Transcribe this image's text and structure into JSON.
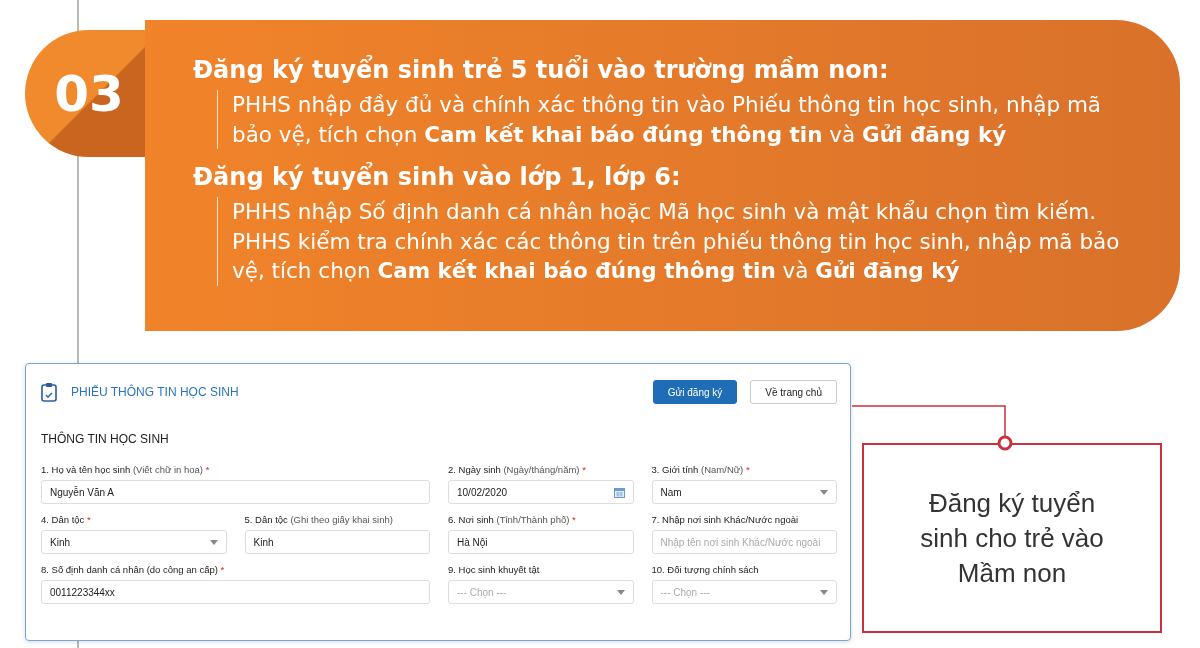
{
  "step": {
    "number": "03"
  },
  "sections": [
    {
      "heading": "Đăng ký tuyển sinh trẻ 5 tuổi vào trường mầm non:",
      "body": "PHHS nhập đầy đủ và chính xác thông tin vào Phiếu thông tin học sinh, nhập mã bảo vệ, tích chọn **Cam kết khai báo đúng thông tin** và **Gửi đăng ký**"
    },
    {
      "heading": "Đăng ký tuyển sinh vào lớp 1, lớp 6:",
      "body": "PHHS nhập Số định danh cá nhân hoặc Mã học sinh và mật khẩu chọn tìm kiếm. PHHS kiểm tra chính xác các thông tin trên phiếu thông tin học sinh, nhập mã bảo vệ, tích chọn **Cam kết khai báo đúng thông tin** và **Gửi đăng ký**"
    }
  ],
  "form": {
    "title": "PHIẾU THÔNG TIN HỌC SINH",
    "buttons": [
      {
        "label": "Gửi đăng ký",
        "kind": "primary"
      },
      {
        "label": "Về trang chủ",
        "kind": "secondary"
      }
    ],
    "section_title": "THÔNG TIN HỌC SINH",
    "fields": [
      {
        "label": "1. Họ và tên học sinh",
        "hint": "(Viết chữ in hoa)",
        "required_mark": "*",
        "kind": "text",
        "wide": true,
        "value": "Nguyễn Văn A"
      },
      {
        "label": "2. Ngày sinh",
        "hint": "(Ngày/tháng/năm)",
        "required_mark": "*",
        "kind": "date",
        "wide": false,
        "value": "10/02/2020"
      },
      {
        "label": "3. Giới tính",
        "hint": "(Nam/Nữ)",
        "required_mark": "*",
        "kind": "select",
        "wide": false,
        "value": "Nam"
      },
      {
        "label": "4. Dân tộc",
        "required_mark": "*",
        "kind": "select",
        "wide": false,
        "value": "Kinh"
      },
      {
        "label": "5. Dân tộc",
        "hint": "(Ghi theo giấy khai sinh)",
        "kind": "text",
        "wide": false,
        "value": "Kinh"
      },
      {
        "label": "6. Nơi sinh",
        "hint": "(Tỉnh/Thành phố)",
        "required_mark": "*",
        "kind": "text",
        "wide": false,
        "value": "Hà Nội"
      },
      {
        "label": "7. Nhập nơi sinh Khác/Nước ngoài",
        "kind": "text",
        "wide": false,
        "placeholder": "Nhập tên nơi sinh Khác/Nước ngoài"
      },
      {
        "label": "8. Số định danh cá nhân (do công an cấp)",
        "required_mark": "*",
        "kind": "text",
        "wide": true,
        "value": "0011223344xx"
      },
      {
        "label": "9. Học sinh khuyết tật",
        "kind": "select",
        "wide": false,
        "placeholder": "--- Chọn ---"
      },
      {
        "label": "10. Đối tượng chính sách",
        "kind": "select",
        "wide": false,
        "placeholder": "--- Chọn ---"
      }
    ]
  },
  "callout": {
    "text": "Đăng ký tuyển sinh cho trẻ vào Mầm non"
  }
}
